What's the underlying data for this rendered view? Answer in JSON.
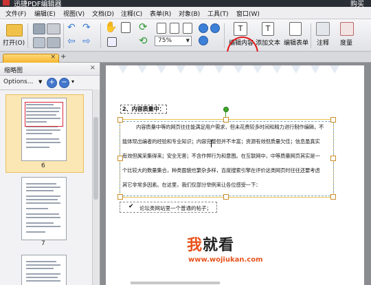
{
  "window": {
    "title": "迅捷PDF编辑器",
    "buy_label": "购买"
  },
  "menu": [
    "文件(F)",
    "编辑(E)",
    "视图(V)",
    "文档(D)",
    "注释(C)",
    "表单(R)",
    "对象(B)",
    "工具(T)",
    "窗口(W)"
  ],
  "toolbar": {
    "open_label": "打开(O)",
    "zoom_value": "75%",
    "edit_content_label": "编辑内容",
    "add_text_label": "添加文本",
    "edit_form_label": "编辑表单",
    "annotate_label": "注释",
    "measure_label": "度量"
  },
  "sidebar": {
    "title": "缩略图",
    "options_label": "Options...",
    "thumbnails": [
      {
        "page": "6",
        "selected": true
      },
      {
        "page": "7",
        "selected": false
      }
    ]
  },
  "document": {
    "heading": "2、内容质量中：",
    "paragraph_lines": [
      "内容质量中等的网页往往能满足用户需求，但未花费较多时间和精力进行制作编辑，不",
      "能体现出编者的经验和专业知识；内容完整但并不丰富；资源有效但质量欠佳；信息虽真实",
      "有效但属采集得来；安全无害；不含作弊行为和意图。在互联网中，中等质量网页其实是一",
      "个比较大的数量集合，种类面貌也繁杂多样，百度搜索引擎在评价这类网页时往往还要考虑",
      "其它非常多因素。在这里，我们仅部分举例来让各位感受一下："
    ],
    "checkbox_item": "论坛类网站里一个普通的帖子；"
  },
  "watermark": {
    "big_prefix": "我",
    "big_rest": "就看",
    "url": "www.wojiukan.com"
  },
  "colors": {
    "highlight_circle": "#e01818",
    "selection_border": "#e9c34a",
    "watermark_accent": "#e8521b"
  }
}
